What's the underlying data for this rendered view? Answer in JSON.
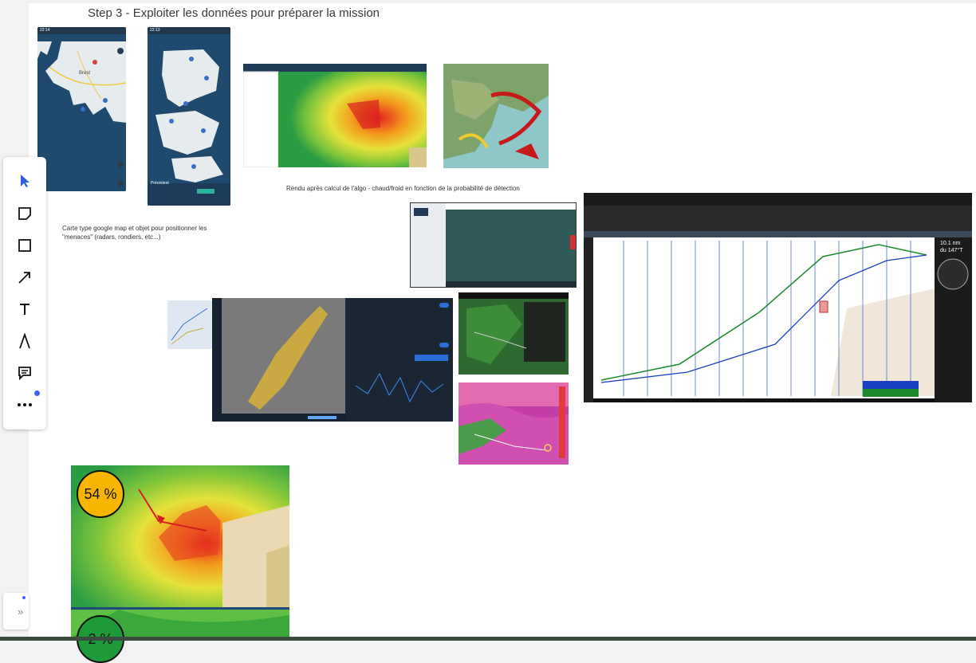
{
  "board": {
    "title": "Step 3 - Exploiter les données pour préparer la mission",
    "caption_map": "Carte type google map et objet pour positionner les \"menaces\" (radars, rondiers, etc...)",
    "caption_algo": "Rendu après calcul de l'algo - chaud/froid en fonction de la probabilité  de détection"
  },
  "phone1": {
    "time": "22:14",
    "city": "Brest"
  },
  "phone2": {
    "time": "22:13",
    "panel_label": "Précédent"
  },
  "badges": {
    "top": "54 %",
    "bottom": "2 %"
  },
  "routing": {
    "readout_distance": "10.1 nm",
    "readout_bearing": "du 147°T"
  },
  "colors": {
    "accent": "#2b6fd6",
    "hot": "#e8231b",
    "cold": "#3aa83a",
    "badge_yellow": "#f7b500",
    "badge_green": "#1f9a3a"
  },
  "toolbar": {
    "tools": [
      "select-icon",
      "sticky-note-icon",
      "rectangle-icon",
      "arrow-icon",
      "text-icon",
      "pen-icon",
      "comment-icon",
      "more-icon"
    ]
  }
}
